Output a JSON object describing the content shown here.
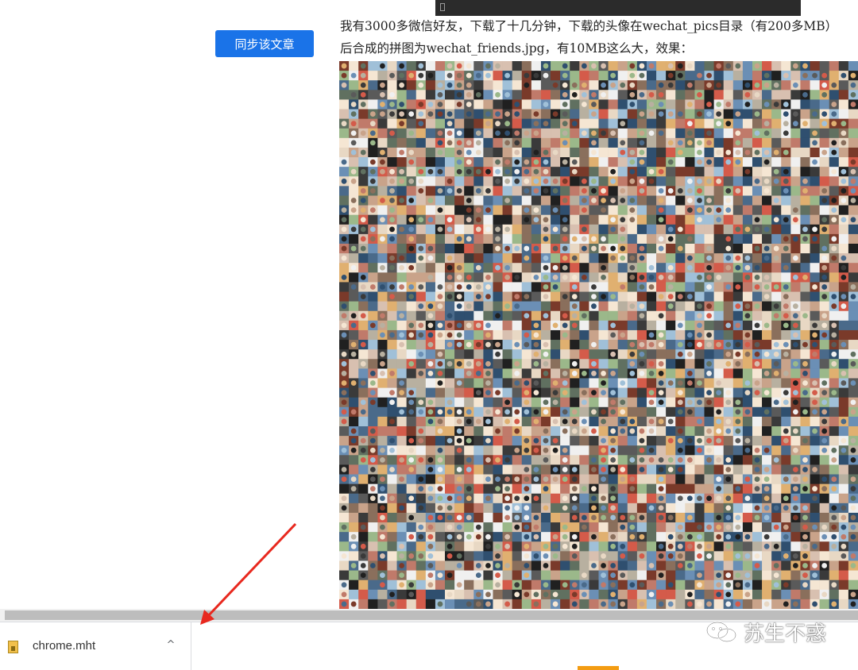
{
  "article": {
    "sync_button_label": "同步该文章",
    "paragraph_line1": "我有3000多微信好友，下载了十几分钟，下载的头像在wechat_pics目录（有200多MB）",
    "paragraph_line2": "后合成的拼图为wechat_friends.jpg，有10MB这么大，效果："
  },
  "download_bar": {
    "filename": "chrome.mht",
    "chevron": "^"
  },
  "watermark": {
    "text": "苏生不惑"
  },
  "colors": {
    "button_blue": "#1a73e8",
    "arrow_red": "#e8281e",
    "scroll_thumb": "#bdbdbd"
  },
  "icons": {
    "file": "file-icon",
    "chevron": "chevron-up-icon",
    "wechat_logo": "wechat-logo-icon"
  }
}
